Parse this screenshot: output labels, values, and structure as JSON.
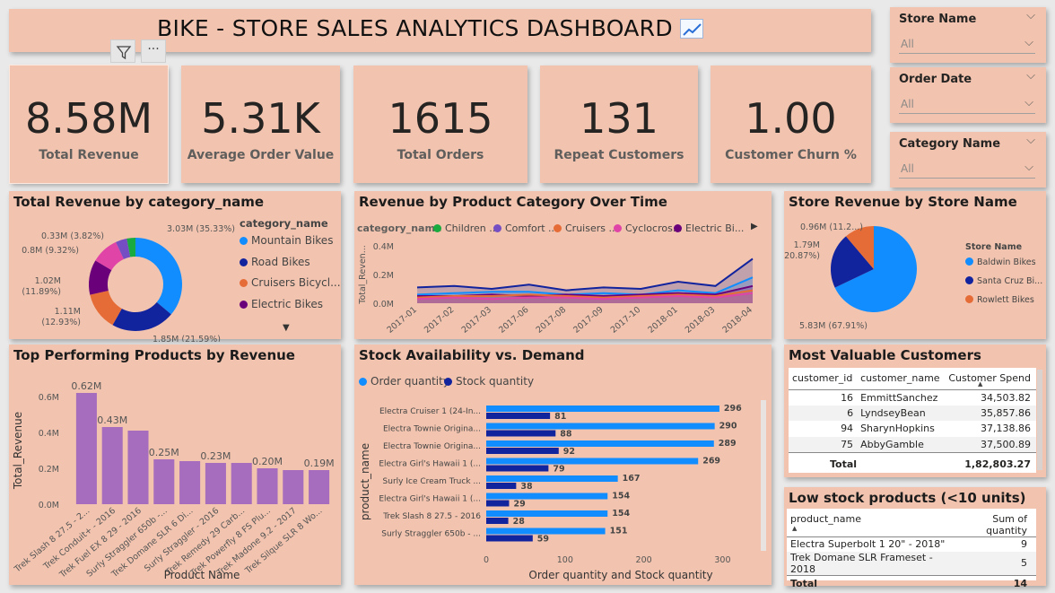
{
  "header": {
    "title": "BIKE - STORE SALES ANALYTICS DASHBOARD",
    "icon": "chart-increasing-icon"
  },
  "kpis": [
    {
      "value": "8.58M",
      "label": "Total Revenue"
    },
    {
      "value": "5.31K",
      "label": "Average Order Value"
    },
    {
      "value": "1615",
      "label": "Total Orders"
    },
    {
      "value": "131",
      "label": "Repeat Customers"
    },
    {
      "value": "1.00",
      "label": "Customer Churn %"
    }
  ],
  "slicers": [
    {
      "title": "Store Name",
      "value": "All"
    },
    {
      "title": "Order Date",
      "value": "All"
    },
    {
      "title": "Category Name",
      "value": "All"
    }
  ],
  "colors": {
    "bg": "#f2c4af",
    "mountain": "#118dff",
    "road": "#12239e",
    "cruisers": "#e66c37",
    "electric": "#6b007b",
    "comfort": "#744ec2",
    "cyclocross": "#e044a7",
    "children": "#1aab40",
    "bar": "#a66cbd"
  },
  "panels": {
    "donut_title": "Total Revenue by category_name",
    "line_title": "Revenue by Product Category Over Time",
    "pie_title": "Store Revenue by Store Name",
    "bar_title": "Top Performing Products by Revenue",
    "stock_title": "Stock Availability vs. Demand",
    "cust_title": "Most Valuable Customers",
    "low_title": "Low stock products (<10 units)"
  },
  "chart_data": [
    {
      "type": "pie",
      "title": "Total Revenue by category_name",
      "legend_title": "category_name",
      "legend": [
        "Mountain Bikes",
        "Road Bikes",
        "Cruisers Bicycl...",
        "Electric Bikes"
      ],
      "slices": [
        {
          "name": "Mountain Bikes",
          "value": 3.03,
          "label": "3.03M (35.33%)",
          "color": "#118dff"
        },
        {
          "name": "Road Bikes",
          "value": 1.85,
          "label": "1.85M (21.59%)",
          "color": "#12239e"
        },
        {
          "name": "Cruisers Bicycles",
          "value": 1.11,
          "label": "1.11M (12.93%)",
          "color": "#e66c37"
        },
        {
          "name": "Electric Bikes",
          "value": 1.02,
          "label": "1.02M (11.89%)",
          "color": "#6b007b"
        },
        {
          "name": "Cyclocross Bicycles",
          "value": 0.8,
          "label": "0.8M (9.32%)",
          "color": "#e044a7"
        },
        {
          "name": "Comfort Bicycles",
          "value": 0.33,
          "label": "0.33M (3.82%)",
          "color": "#744ec2"
        },
        {
          "name": "Children Bicycles",
          "value": 0.25,
          "label": "",
          "color": "#1aab40"
        }
      ]
    },
    {
      "type": "area",
      "title": "Revenue by Product Category Over Time",
      "legend_title": "category_name",
      "legend": [
        "Children ...",
        "Comfort ...",
        "Cruisers ...",
        "Cyclocros...",
        "Electric Bi..."
      ],
      "ylabel": "Total_Reven...",
      "yticks": [
        "0.0M",
        "0.2M",
        "0.4M"
      ],
      "ylim": [
        0,
        0.4
      ],
      "x": [
        "2017-01",
        "2017-02",
        "2017-03",
        "2017-06",
        "2017-08",
        "2017-09",
        "2017-10",
        "2018-01",
        "2018-03",
        "2018-04"
      ],
      "series": [
        {
          "color": "#12239e",
          "values": [
            0.11,
            0.12,
            0.1,
            0.13,
            0.09,
            0.11,
            0.1,
            0.15,
            0.12,
            0.31
          ]
        },
        {
          "color": "#118dff",
          "values": [
            0.06,
            0.07,
            0.08,
            0.08,
            0.06,
            0.07,
            0.06,
            0.09,
            0.07,
            0.18
          ]
        },
        {
          "color": "#6b007b",
          "values": [
            0.05,
            0.05,
            0.06,
            0.05,
            0.06,
            0.05,
            0.06,
            0.07,
            0.06,
            0.12
          ]
        },
        {
          "color": "#e66c37",
          "values": [
            0.04,
            0.05,
            0.05,
            0.06,
            0.05,
            0.04,
            0.05,
            0.06,
            0.05,
            0.09
          ]
        },
        {
          "color": "#e044a7",
          "values": [
            0.03,
            0.04,
            0.03,
            0.04,
            0.04,
            0.03,
            0.04,
            0.05,
            0.04,
            0.07
          ]
        }
      ]
    },
    {
      "type": "pie",
      "title": "Store Revenue by Store Name",
      "legend_title": "Store Name",
      "legend": [
        "Baldwin Bikes",
        "Santa Cruz Bi...",
        "Rowlett Bikes"
      ],
      "slices": [
        {
          "name": "Baldwin Bikes",
          "value": 5.83,
          "label": "5.83M (67.91%)",
          "color": "#118dff"
        },
        {
          "name": "Santa Cruz Bikes",
          "value": 1.79,
          "label": "1.79M (20.87%)",
          "color": "#12239e"
        },
        {
          "name": "Rowlett Bikes",
          "value": 0.96,
          "label": "0.96M (11.2...)",
          "color": "#e66c37"
        }
      ]
    },
    {
      "type": "bar",
      "title": "Top Performing Products by Revenue",
      "xlabel": "Product Name",
      "ylabel": "Total_Revenue",
      "yticks": [
        "0.0M",
        "0.2M",
        "0.4M",
        "0.6M"
      ],
      "ylim": [
        0,
        0.65
      ],
      "categories": [
        "Trek Slash 8 27.5 - 2...",
        "Trek Conduit+ - 2016",
        "Trek Fuel EX 8 29 - 2016",
        "Surly Straggler 650b -...",
        "Trek Domane SLR 6 Di...",
        "Surly Straggler - 2016",
        "Trek Remedy 29 Carb...",
        "Trek Powerfly 8 FS Plu...",
        "Trek Madone 9.2 - 2017",
        "Trek Silque SLR 8 Wo..."
      ],
      "values": [
        0.62,
        0.43,
        0.41,
        0.25,
        0.24,
        0.23,
        0.23,
        0.2,
        0.19,
        0.19
      ],
      "labels": [
        "0.62M",
        "0.43M",
        "",
        "0.25M",
        "",
        "0.23M",
        "",
        "0.20M",
        "",
        "0.19M"
      ]
    },
    {
      "type": "bar",
      "orientation": "horizontal",
      "title": "Stock Availability vs. Demand",
      "xlabel": "Order quantity and Stock quantity",
      "ylabel": "product_name",
      "xticks": [
        "0",
        "100",
        "200",
        "300"
      ],
      "xlim": [
        0,
        320
      ],
      "legend": [
        "Order quantity",
        "Stock quantity"
      ],
      "categories": [
        "Electra Cruiser 1 (24-In...",
        "Electra Townie Origina...",
        "Electra Townie Origina...",
        "Electra Girl's Hawaii 1 (...",
        "Surly Ice Cream Truck ...",
        "Electra Girl's Hawaii 1 (...",
        "Trek Slash 8 27.5 - 2016",
        "Surly Straggler 650b - ..."
      ],
      "series": [
        {
          "name": "Order quantity",
          "values": [
            296,
            290,
            289,
            269,
            167,
            154,
            154,
            151
          ]
        },
        {
          "name": "Stock quantity",
          "values": [
            81,
            88,
            92,
            79,
            38,
            29,
            28,
            59
          ]
        }
      ]
    }
  ],
  "customers": {
    "headers": [
      "customer_id",
      "customer_name",
      "Customer Spend"
    ],
    "rows": [
      [
        "16",
        "EmmittSanchez",
        "34,503.82"
      ],
      [
        "6",
        "LyndseyBean",
        "35,857.86"
      ],
      [
        "94",
        "SharynHopkins",
        "37,138.86"
      ],
      [
        "75",
        "AbbyGamble",
        "37,500.89"
      ]
    ],
    "total_label": "Total",
    "total": "1,82,803.27"
  },
  "low_stock": {
    "headers": [
      "product_name",
      "Sum of quantity"
    ],
    "rows": [
      [
        "Electra Superbolt 1 20\" - 2018\"",
        "9"
      ],
      [
        "Trek Domane SLR Frameset - 2018",
        "5"
      ]
    ],
    "total_label": "Total",
    "total": "14"
  }
}
